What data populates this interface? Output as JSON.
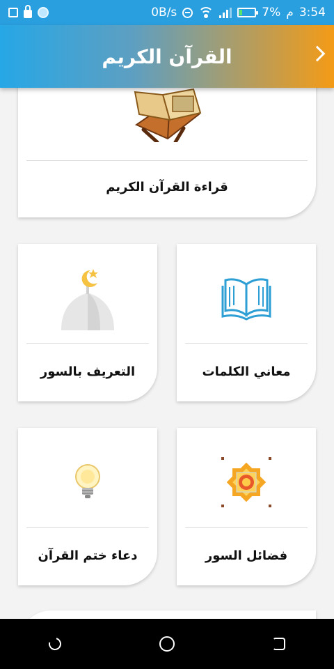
{
  "status_bar": {
    "speed": "0B/s",
    "battery": "7%",
    "time_suffix": "م",
    "time": "3:54"
  },
  "app_bar": {
    "title": "القرآن الكريم"
  },
  "cards": {
    "read_quran": "قراءة القرآن الكريم",
    "word_meanings": "معاني الكلمات",
    "surah_intro": "التعريف بالسور",
    "surah_virtues": "فضائل السور",
    "khatm_dua": "دعاء ختم القرآن"
  },
  "icons": {
    "read_quran": "quran-stand-icon",
    "word_meanings": "open-book-icon",
    "surah_intro": "mosque-dome-icon",
    "surah_virtues": "islamic-star-icon",
    "khatm_dua": "light-bulb-icon"
  },
  "colors": {
    "appbar_start": "#26a7e6",
    "appbar_end": "#f49b16",
    "card_bg": "#ffffff",
    "page_bg": "#f3f3f3"
  }
}
